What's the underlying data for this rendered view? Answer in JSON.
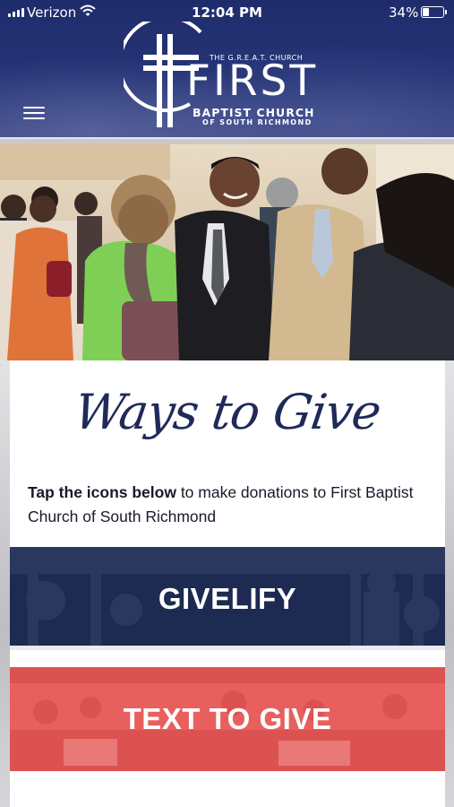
{
  "status_bar": {
    "carrier": "Verizon",
    "time": "12:04 PM",
    "battery_percent": "34%",
    "battery_level": 0.34
  },
  "header": {
    "logo": {
      "tagline": "THE G.R.E.A.T. CHURCH",
      "name": "FIRST",
      "line1": "BAPTIST CHURCH",
      "line2": "OF SOUTH RICHMOND"
    },
    "menu_icon": "hamburger-menu-icon"
  },
  "hero_image": "congregation-greeting-photo",
  "content": {
    "title": "Ways to Give",
    "intro_bold": "Tap the icons below",
    "intro_rest": " to make donations to First Baptist Church of South Richmond",
    "buttons": {
      "givelify": "GIVELIFY",
      "text_to_give": "TEXT TO GIVE"
    }
  },
  "colors": {
    "header_navy": "#253476",
    "givelify_bg": "#1d2a52",
    "text_to_give_bg": "#e8605d",
    "title_color": "#1f2a5a"
  }
}
